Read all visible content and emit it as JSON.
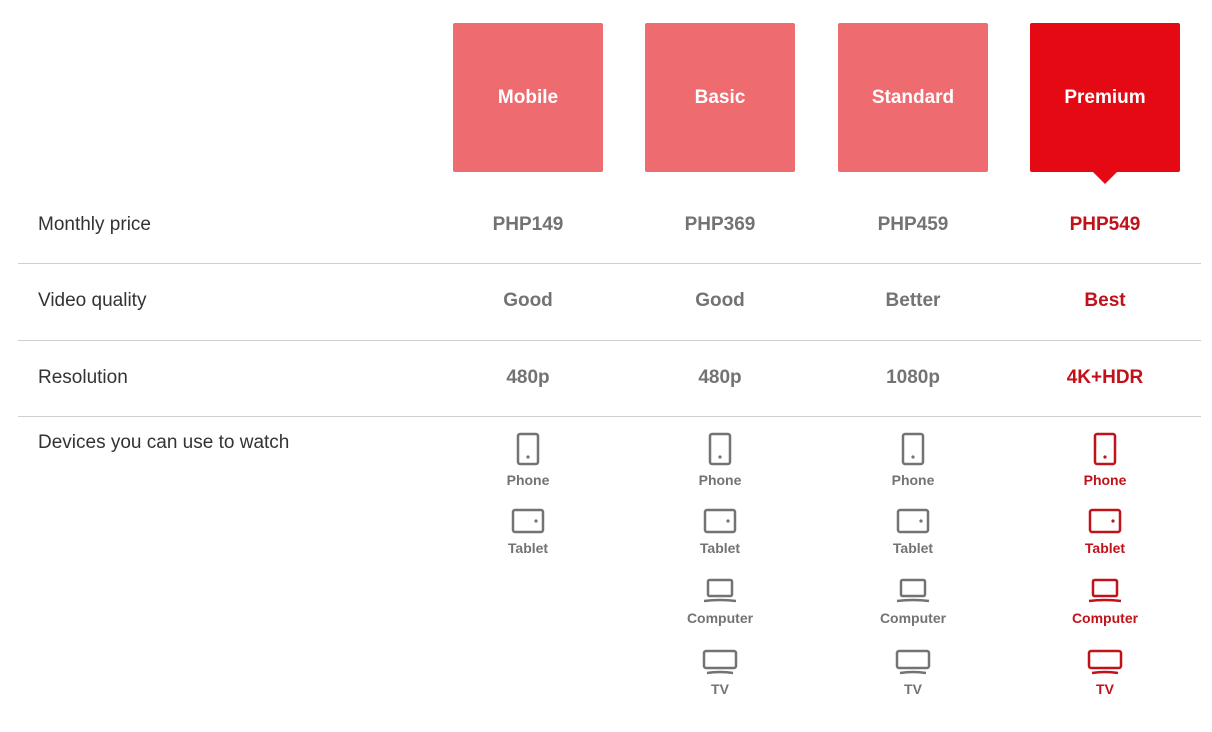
{
  "plans": [
    {
      "name": "Mobile",
      "selected": false
    },
    {
      "name": "Basic",
      "selected": false
    },
    {
      "name": "Standard",
      "selected": false
    },
    {
      "name": "Premium",
      "selected": true
    }
  ],
  "colors": {
    "card_unselected": "#ee6b70",
    "card_selected": "#e50914",
    "text_unselected": "#737373",
    "text_selected": "#c11119"
  },
  "rows": {
    "monthly_price": {
      "label": "Monthly price",
      "values": [
        "PHP149",
        "PHP369",
        "PHP459",
        "PHP549"
      ]
    },
    "video_quality": {
      "label": "Video quality",
      "values": [
        "Good",
        "Good",
        "Better",
        "Best"
      ]
    },
    "resolution": {
      "label": "Resolution",
      "values": [
        "480p",
        "480p",
        "1080p",
        "4K+HDR"
      ]
    },
    "devices": {
      "label": "Devices you can use to watch",
      "columns": [
        [
          {
            "name": "Phone",
            "icon": "phone-icon"
          },
          {
            "name": "Tablet",
            "icon": "tablet-icon"
          }
        ],
        [
          {
            "name": "Phone",
            "icon": "phone-icon"
          },
          {
            "name": "Tablet",
            "icon": "tablet-icon"
          },
          {
            "name": "Computer",
            "icon": "computer-icon"
          },
          {
            "name": "TV",
            "icon": "tv-icon"
          }
        ],
        [
          {
            "name": "Phone",
            "icon": "phone-icon"
          },
          {
            "name": "Tablet",
            "icon": "tablet-icon"
          },
          {
            "name": "Computer",
            "icon": "computer-icon"
          },
          {
            "name": "TV",
            "icon": "tv-icon"
          }
        ],
        [
          {
            "name": "Phone",
            "icon": "phone-icon"
          },
          {
            "name": "Tablet",
            "icon": "tablet-icon"
          },
          {
            "name": "Computer",
            "icon": "computer-icon"
          },
          {
            "name": "TV",
            "icon": "tv-icon"
          }
        ]
      ]
    }
  }
}
